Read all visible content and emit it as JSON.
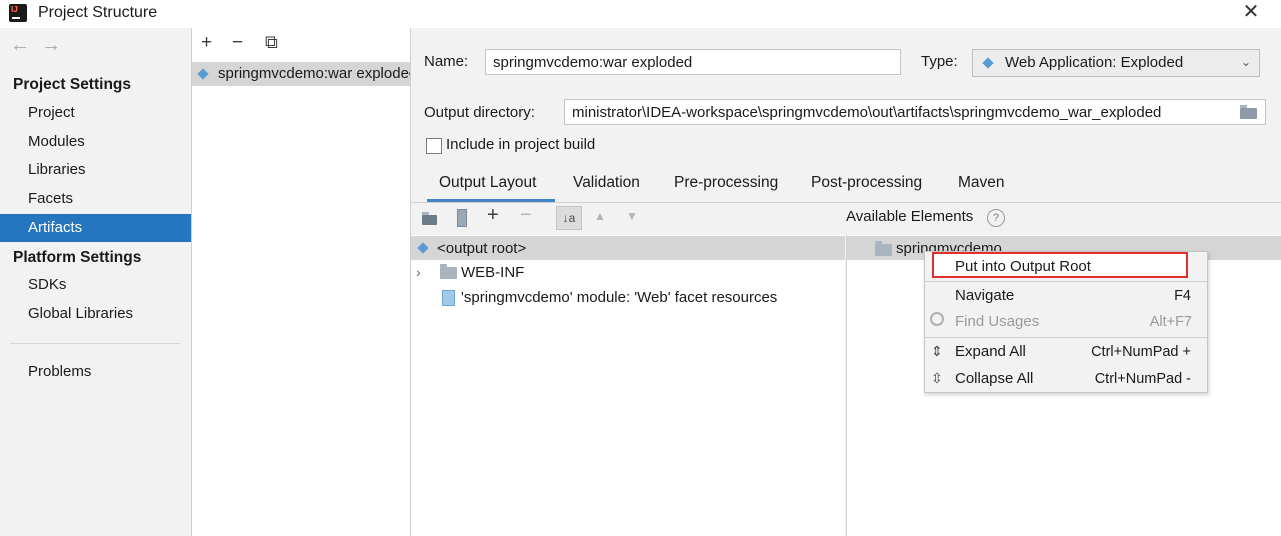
{
  "window": {
    "title": "Project Structure",
    "close_glyph": "✕"
  },
  "nav": {
    "back": "←",
    "forward": "→"
  },
  "sidebar": {
    "project_settings_header": "Project Settings",
    "items": [
      {
        "label": "Project"
      },
      {
        "label": "Modules"
      },
      {
        "label": "Libraries"
      },
      {
        "label": "Facets"
      },
      {
        "label": "Artifacts",
        "selected": true
      }
    ],
    "platform_settings_header": "Platform Settings",
    "platform_items": [
      {
        "label": "SDKs"
      },
      {
        "label": "Global Libraries"
      }
    ],
    "problems": "Problems"
  },
  "artifacts_toolbar": {
    "add": "+",
    "remove": "−",
    "copy": "⧉"
  },
  "artifact_list": [
    "springmvcdemo:war exploded"
  ],
  "form": {
    "name_label": "Name:",
    "name_value": "springmvcdemo:war exploded",
    "type_label": "Type:",
    "type_value": "Web Application: Exploded",
    "output_dir_label": "Output directory:",
    "output_dir_value": "ministrator\\IDEA-workspace\\springmvcdemo\\out\\artifacts\\springmvcdemo_war_exploded",
    "include_build_label": "Include in project build",
    "include_build_checked": false
  },
  "tabs": [
    {
      "label": "Output Layout",
      "active": true
    },
    {
      "label": "Validation"
    },
    {
      "label": "Pre-processing"
    },
    {
      "label": "Post-processing"
    },
    {
      "label": "Maven"
    }
  ],
  "layout_tree": [
    {
      "label": "<output root>",
      "selected": true,
      "icon": "output-root-icon"
    },
    {
      "label": "WEB-INF",
      "icon": "folder-icon",
      "expandable": true
    },
    {
      "label": "'springmvcdemo' module: 'Web' facet resources",
      "icon": "web-facet-icon"
    }
  ],
  "available": {
    "header": "Available Elements",
    "help": "?",
    "items": [
      {
        "label": "springmvcdemo",
        "icon": "module-folder-icon"
      }
    ]
  },
  "context_menu": {
    "items": [
      {
        "label": "Put into Output Root",
        "shortcut": "",
        "highlighted": true
      },
      {
        "label": "Navigate",
        "shortcut": "F4"
      },
      {
        "label": "Find Usages",
        "shortcut": "Alt+F7",
        "disabled": true
      },
      {
        "label": "Expand All",
        "shortcut": "Ctrl+NumPad +"
      },
      {
        "label": "Collapse All",
        "shortcut": "Ctrl+NumPad -"
      }
    ]
  },
  "colors": {
    "selection": "#2675bf",
    "highlight_border": "#e0302a",
    "tab_underline": "#4083c9"
  }
}
